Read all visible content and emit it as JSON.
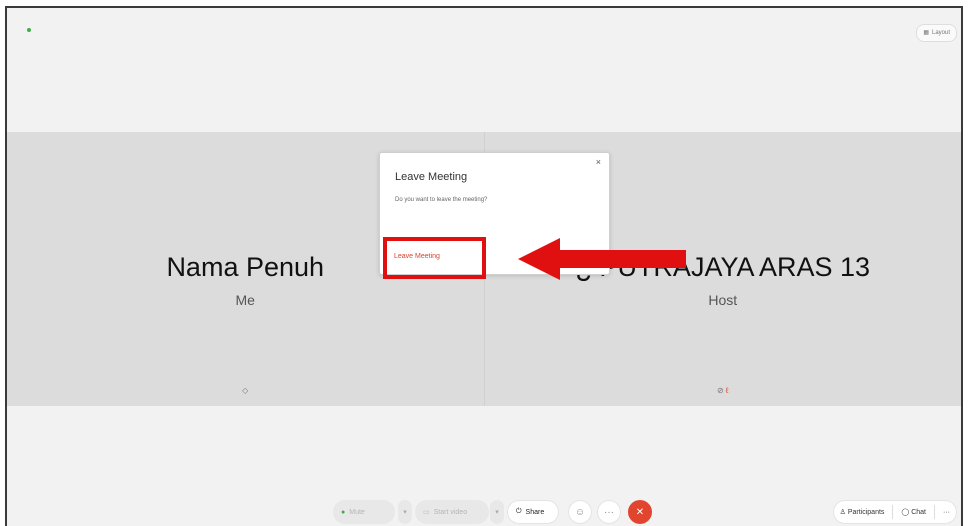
{
  "header": {
    "layout_label": "Layout"
  },
  "tiles": [
    {
      "name": "Nama Penuh",
      "role": "Me",
      "status_icon": "◇"
    },
    {
      "name": "¿ PUTRAJAYA ARAS 13",
      "role": "Host",
      "status_icon": "⊘",
      "status_extra": "ℓ"
    }
  ],
  "dialog": {
    "title": "Leave Meeting",
    "message": "Do you want to leave the meeting?",
    "button_label": "Leave Meeting",
    "close_glyph": "×"
  },
  "toolbar": {
    "mute_label": "Mute",
    "start_video_label": "Start video",
    "share_label": "Share",
    "more_glyph": "···",
    "end_glyph": "✕",
    "participants_label": "Participants",
    "chat_label": "Chat"
  },
  "colors": {
    "accent_red": "#e01010",
    "end_call": "#e2452f",
    "leave_text": "#d9432f",
    "status_green": "#3fae49"
  }
}
